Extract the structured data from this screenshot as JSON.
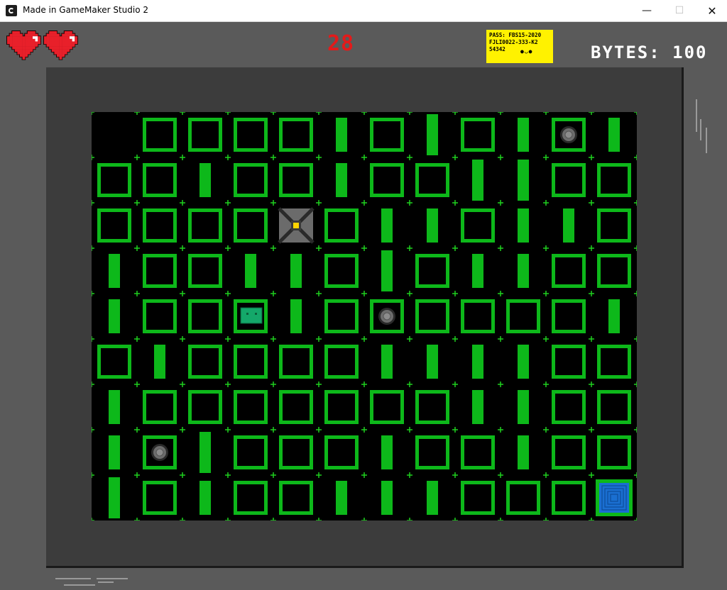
{
  "window": {
    "title": "Made in GameMaker Studio 2",
    "minimize_glyph": "—",
    "maximize_glyph": "☐",
    "close_glyph": "✕"
  },
  "hud": {
    "lives": 2,
    "heart_color": "#e8202a",
    "counter": "28",
    "counter_color": "#e31a1a",
    "note": {
      "lines": [
        "PASS: FBS15-2020",
        "FJLI0022-333-K2",
        "54342"
      ],
      "symbols": "●◡●",
      "background": "#fff200"
    },
    "bytes_label": "BYTES: 100"
  },
  "board": {
    "grid_color": "#1fd11f",
    "wall_fill": "#0db81a",
    "cols": 12,
    "rows": 9,
    "legend": {
      "B": "box",
      "T": "tall pillar",
      "S": "short pillar",
      ".": "empty",
      "P": "player",
      "D": "disc in box",
      "G": "chest in box",
      "X": "exit portal"
    },
    "rows_layout": [
      ".BBBBSBTBSDS",
      "BBSBBSBBTTBB",
      "BBBBPBSSBSSB",
      "SBBSSBTBSSBB",
      "SBBGSBDBBBBS",
      "BSBBBBSSSSBB",
      "SBBBBBBBSSBB",
      "SDTBBBSBBSBB",
      "TBSBBSSSBBBX"
    ]
  }
}
